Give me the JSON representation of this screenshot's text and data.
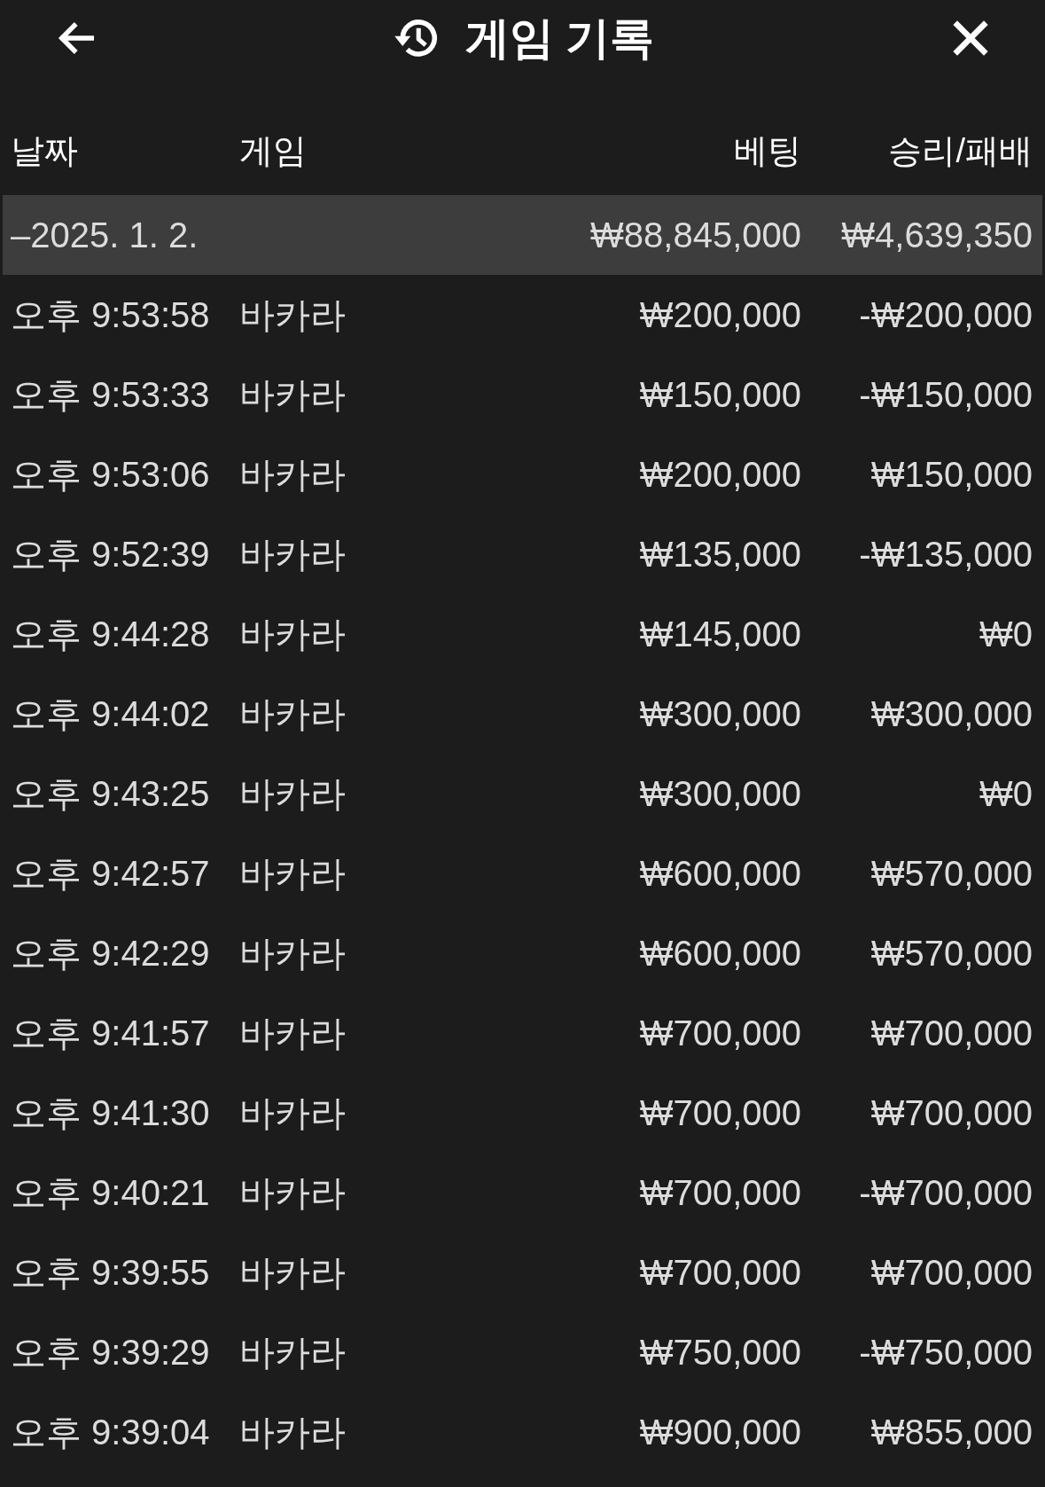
{
  "header": {
    "title": "게임 기록"
  },
  "columns": [
    "날짜",
    "게임",
    "베팅",
    "승리/패배"
  ],
  "groups": [
    {
      "date": "–2025. 1. 2.",
      "bet_total": "₩88,845,000",
      "result_total": "₩4,639,350",
      "rows": [
        {
          "time": "오후 9:53:58",
          "game": "바카라",
          "bet": "₩200,000",
          "result": "-₩200,000"
        },
        {
          "time": "오후 9:53:33",
          "game": "바카라",
          "bet": "₩150,000",
          "result": "-₩150,000"
        },
        {
          "time": "오후 9:53:06",
          "game": "바카라",
          "bet": "₩200,000",
          "result": "₩150,000"
        },
        {
          "time": "오후 9:52:39",
          "game": "바카라",
          "bet": "₩135,000",
          "result": "-₩135,000"
        },
        {
          "time": "오후 9:44:28",
          "game": "바카라",
          "bet": "₩145,000",
          "result": "₩0"
        },
        {
          "time": "오후 9:44:02",
          "game": "바카라",
          "bet": "₩300,000",
          "result": "₩300,000"
        },
        {
          "time": "오후 9:43:25",
          "game": "바카라",
          "bet": "₩300,000",
          "result": "₩0"
        },
        {
          "time": "오후 9:42:57",
          "game": "바카라",
          "bet": "₩600,000",
          "result": "₩570,000"
        },
        {
          "time": "오후 9:42:29",
          "game": "바카라",
          "bet": "₩600,000",
          "result": "₩570,000"
        },
        {
          "time": "오후 9:41:57",
          "game": "바카라",
          "bet": "₩700,000",
          "result": "₩700,000"
        },
        {
          "time": "오후 9:41:30",
          "game": "바카라",
          "bet": "₩700,000",
          "result": "₩700,000"
        },
        {
          "time": "오후 9:40:21",
          "game": "바카라",
          "bet": "₩700,000",
          "result": "-₩700,000"
        },
        {
          "time": "오후 9:39:55",
          "game": "바카라",
          "bet": "₩700,000",
          "result": "₩700,000"
        },
        {
          "time": "오후 9:39:29",
          "game": "바카라",
          "bet": "₩750,000",
          "result": "-₩750,000"
        },
        {
          "time": "오후 9:39:04",
          "game": "바카라",
          "bet": "₩900,000",
          "result": "₩855,000"
        }
      ]
    }
  ]
}
